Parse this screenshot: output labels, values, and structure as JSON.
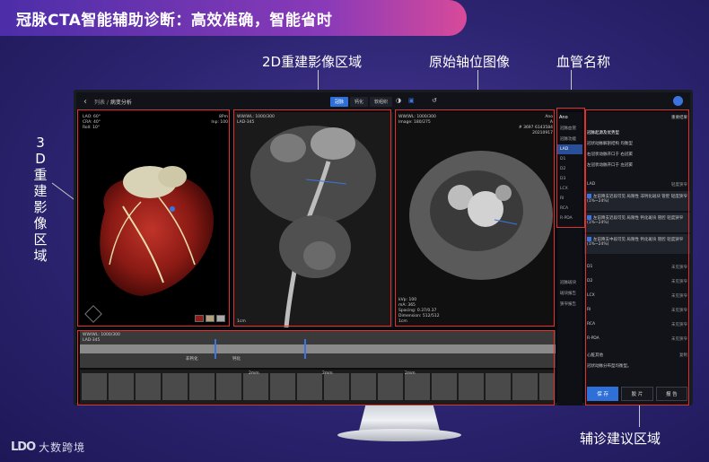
{
  "slide": {
    "title": "冠脉CTA智能辅助诊断：高效准确，智能省时",
    "callouts": {
      "recon_2d": "2D重建影像区域",
      "axial": "原始轴位图像",
      "vessel_names": "血管名称",
      "recon_3d": "3D重建影像区域",
      "advice": "辅诊建议区域"
    },
    "brand": {
      "mark": "LDO",
      "name": "大数跨境"
    }
  },
  "app": {
    "top": {
      "back": "‹",
      "breadcrumb_1": "列表",
      "breadcrumb_2": "病变分析",
      "modes": [
        "冠脉",
        "钙化",
        "软组织"
      ],
      "active_mode": "冠脉"
    },
    "pane_3d": {
      "tl": [
        "LAO: 60°",
        "CRA: 40°",
        "Roll: 10°"
      ],
      "tr": [
        "8Pm",
        "Inp: 100"
      ]
    },
    "pane_2d": {
      "tl": [
        "WW/WL: 1000/300",
        "LAD-345"
      ],
      "bl": [
        "1cm"
      ]
    },
    "pane_axial": {
      "tl": [
        "WW/WL: 1000/300",
        "Image: 180/275"
      ],
      "tr": [
        "Ano",
        "A",
        "# 3697 6143584",
        "20210917"
      ],
      "bl": [
        "kVp: 100",
        "mA: 365",
        "Spacing: 0.37/0.37",
        "Dimension: 512/512",
        "1cm"
      ]
    },
    "pane_strip": {
      "tl": [
        "WW/WL: 1000/300",
        "LAD-345"
      ],
      "labels": [
        "非钙化",
        "钙化"
      ],
      "marks": [
        "2mm",
        "2mm",
        "2mm"
      ]
    },
    "vessels": {
      "header": "Ano",
      "sub1": "冠脉血管",
      "sub2": "冠脉功能",
      "items": [
        "LAD",
        "D1",
        "D2",
        "D3",
        "LCX",
        "RI",
        "RCA",
        "R-PDA"
      ],
      "active": "LAD",
      "footer": [
        "冠脉斑块",
        "斑块报告",
        "狭窄报告"
      ]
    },
    "advice": {
      "toggle": "重要结果",
      "head": "冠脉起源及优势型",
      "lines": [
        "冠状动脉解剖结构 均衡型",
        "右冠状动脉开口于 右冠窦",
        "左冠状动脉开口于 左冠窦"
      ],
      "lad_label": "LAD",
      "lad_status": "轻度狭窄",
      "lad_items": [
        "左前降支近段可见 局限性  非钙化斑块 管腔 轻度狭窄(1%~24%)",
        "左前降支近段可见 局限性  钙化斑块 管腔 轻度狭窄(1%~24%)",
        "左前降支中段可见 局限性  钙化斑块 管腔 轻度狭窄(1%~24%)"
      ],
      "rows": [
        {
          "name": "D1",
          "status": "未见狭窄"
        },
        {
          "name": "D2",
          "status": "未见狭窄"
        },
        {
          "name": "LCX",
          "status": "未见狭窄"
        },
        {
          "name": "RI",
          "status": "未见狭窄"
        },
        {
          "name": "RCA",
          "status": "未见狭窄"
        },
        {
          "name": "R-PDA",
          "status": "未见狭窄"
        }
      ],
      "other_label": "心脏其他",
      "other_action": "复制",
      "other_text": "冠状动脉分布型均衡型。",
      "buttons": [
        "保 存",
        "胶 片",
        "报 告"
      ]
    }
  }
}
